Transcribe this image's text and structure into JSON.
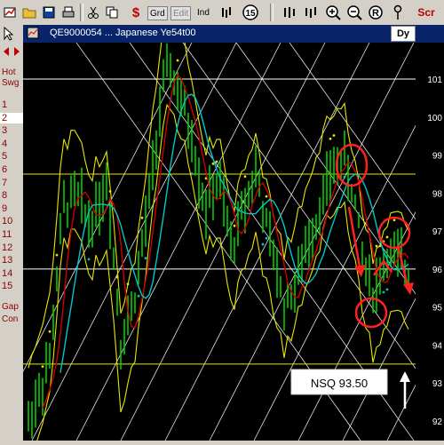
{
  "toolbar": {
    "items": [
      {
        "name": "open-folder-icon",
        "label": ""
      },
      {
        "name": "save-icon",
        "label": ""
      },
      {
        "name": "print-icon",
        "label": ""
      },
      {
        "name": "dollar-icon",
        "label": "$"
      },
      {
        "name": "grid-button",
        "label": "Grd"
      },
      {
        "name": "edit-button",
        "label": "Edit"
      },
      {
        "name": "ind-button",
        "label": "Ind"
      },
      {
        "name": "cycle-button",
        "label": "15"
      },
      {
        "name": "scr-button",
        "label": "Scr"
      }
    ]
  },
  "sidebar": {
    "top_label_1": "Hot",
    "top_label_2": "Swg",
    "numbers": [
      "1",
      "2",
      "3",
      "4",
      "5",
      "6",
      "7",
      "8",
      "9",
      "10",
      "11",
      "12",
      "13",
      "14",
      "15"
    ],
    "selected": "2",
    "gap_label": "Gap",
    "con_label": "Con"
  },
  "window": {
    "title": "QE9000054 ... Japanese Ye54t00",
    "period_button": "Dy"
  },
  "chart_data": {
    "type": "bar",
    "y_axis_ticks": [
      "101",
      "100",
      "99",
      "98",
      "97",
      "96",
      "95",
      "94",
      "93",
      "92"
    ],
    "ylim": [
      91.6,
      101.8
    ],
    "horizontal_levels": [
      {
        "value": 101,
        "color": "#ffffff"
      },
      {
        "value": 98.5,
        "color": "#e6e600"
      },
      {
        "value": 96,
        "color": "#ffffff"
      },
      {
        "value": 93.5,
        "color": "#e6e600"
      }
    ],
    "annotation": {
      "text": "NSQ 93.50"
    },
    "colors": {
      "bars": "#00d000",
      "envelope": "#e6e600",
      "ma_fast": "#cc0000",
      "ma_slow": "#00c8c8",
      "markup": "#ff2020",
      "fan": "#ffffff"
    }
  }
}
